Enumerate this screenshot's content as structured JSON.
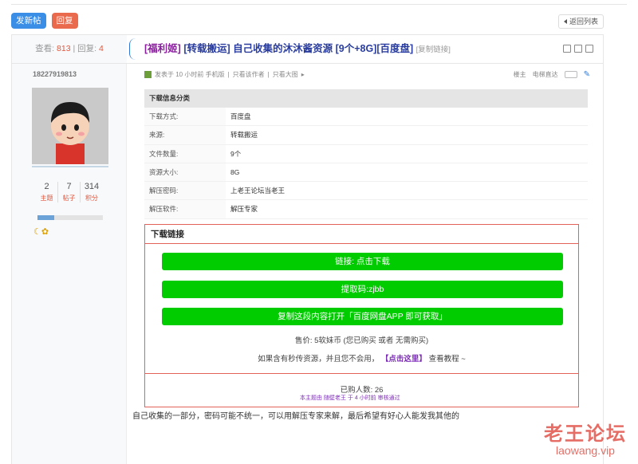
{
  "toolbar": {
    "new_post": "发新帖",
    "reply": "回复",
    "back": "返回列表"
  },
  "thread": {
    "stats_view_label": "查看:",
    "views": "813",
    "stats_reply_label": "回复:",
    "replies": "4",
    "tag": "[福利姬]",
    "title": "[转载搬运] 自己收集的沐沐酱资源 [9个+8G][百度盘]",
    "copy_link": "[复制链接]"
  },
  "user": {
    "name": "18227919813",
    "stats": [
      {
        "value": "2",
        "label": "主题"
      },
      {
        "value": "7",
        "label": "帖子"
      },
      {
        "value": "314",
        "label": "积分"
      }
    ],
    "level_progress": 0.25,
    "medals": "☾✿"
  },
  "post_meta": {
    "posted": "发表于 10 小时前 手机版",
    "only_author": "只看该作者",
    "only_large": "只看大图",
    "floor": "楼主",
    "direct": "电梯直达"
  },
  "info": {
    "header": "下载信息分类",
    "rows": [
      {
        "key": "下载方式:",
        "value": "百度盘"
      },
      {
        "key": "来源:",
        "value": "转载搬运"
      },
      {
        "key": "文件数量:",
        "value": "9个"
      },
      {
        "key": "资源大小:",
        "value": "8G"
      },
      {
        "key": "解压密码:",
        "value": "上老王论坛当老王"
      },
      {
        "key": "解压软件:",
        "value": "解压专家"
      }
    ]
  },
  "download": {
    "title": "下载链接",
    "btn_link": "链接: 点击下载",
    "btn_code": "提取码:zjbb",
    "btn_copy": "复制这段内容打开「百度网盘APP 即可获取」",
    "price": "售价: 5软妹币 (您已购买 或者 无需购买)",
    "tip_pre": "如果含有秒传资源，并且您不会用，",
    "tip_link": "【点击这里】",
    "tip_post": " 查看教程 ~",
    "buyers": "已购人数: 26"
  },
  "audit": "本主题由 随壁老王 于 4 小时前 审核通过",
  "body_text": "自己收集的一部分，密码可能不统一，可以用解压专家来解，最后希望有好心人能发我其他的",
  "watermark": {
    "zh": "老王论坛",
    "en": "laowang.vip"
  }
}
